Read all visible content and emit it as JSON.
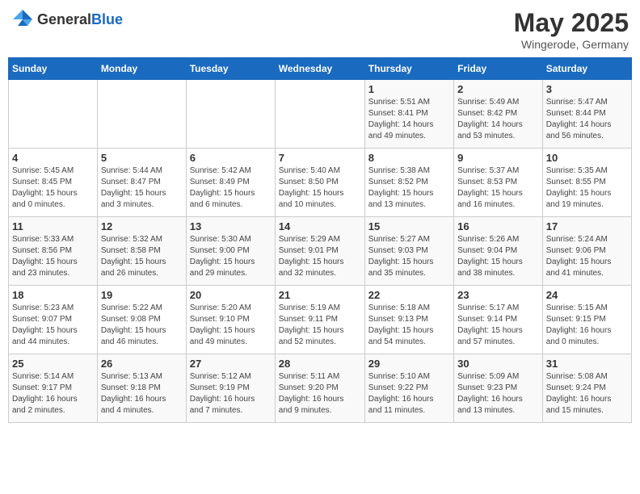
{
  "header": {
    "logo_general": "General",
    "logo_blue": "Blue",
    "title": "May 2025",
    "subtitle": "Wingerode, Germany"
  },
  "weekdays": [
    "Sunday",
    "Monday",
    "Tuesday",
    "Wednesday",
    "Thursday",
    "Friday",
    "Saturday"
  ],
  "weeks": [
    [
      {
        "day": "",
        "info": ""
      },
      {
        "day": "",
        "info": ""
      },
      {
        "day": "",
        "info": ""
      },
      {
        "day": "",
        "info": ""
      },
      {
        "day": "1",
        "info": "Sunrise: 5:51 AM\nSunset: 8:41 PM\nDaylight: 14 hours\nand 49 minutes."
      },
      {
        "day": "2",
        "info": "Sunrise: 5:49 AM\nSunset: 8:42 PM\nDaylight: 14 hours\nand 53 minutes."
      },
      {
        "day": "3",
        "info": "Sunrise: 5:47 AM\nSunset: 8:44 PM\nDaylight: 14 hours\nand 56 minutes."
      }
    ],
    [
      {
        "day": "4",
        "info": "Sunrise: 5:45 AM\nSunset: 8:45 PM\nDaylight: 15 hours\nand 0 minutes."
      },
      {
        "day": "5",
        "info": "Sunrise: 5:44 AM\nSunset: 8:47 PM\nDaylight: 15 hours\nand 3 minutes."
      },
      {
        "day": "6",
        "info": "Sunrise: 5:42 AM\nSunset: 8:49 PM\nDaylight: 15 hours\nand 6 minutes."
      },
      {
        "day": "7",
        "info": "Sunrise: 5:40 AM\nSunset: 8:50 PM\nDaylight: 15 hours\nand 10 minutes."
      },
      {
        "day": "8",
        "info": "Sunrise: 5:38 AM\nSunset: 8:52 PM\nDaylight: 15 hours\nand 13 minutes."
      },
      {
        "day": "9",
        "info": "Sunrise: 5:37 AM\nSunset: 8:53 PM\nDaylight: 15 hours\nand 16 minutes."
      },
      {
        "day": "10",
        "info": "Sunrise: 5:35 AM\nSunset: 8:55 PM\nDaylight: 15 hours\nand 19 minutes."
      }
    ],
    [
      {
        "day": "11",
        "info": "Sunrise: 5:33 AM\nSunset: 8:56 PM\nDaylight: 15 hours\nand 23 minutes."
      },
      {
        "day": "12",
        "info": "Sunrise: 5:32 AM\nSunset: 8:58 PM\nDaylight: 15 hours\nand 26 minutes."
      },
      {
        "day": "13",
        "info": "Sunrise: 5:30 AM\nSunset: 9:00 PM\nDaylight: 15 hours\nand 29 minutes."
      },
      {
        "day": "14",
        "info": "Sunrise: 5:29 AM\nSunset: 9:01 PM\nDaylight: 15 hours\nand 32 minutes."
      },
      {
        "day": "15",
        "info": "Sunrise: 5:27 AM\nSunset: 9:03 PM\nDaylight: 15 hours\nand 35 minutes."
      },
      {
        "day": "16",
        "info": "Sunrise: 5:26 AM\nSunset: 9:04 PM\nDaylight: 15 hours\nand 38 minutes."
      },
      {
        "day": "17",
        "info": "Sunrise: 5:24 AM\nSunset: 9:06 PM\nDaylight: 15 hours\nand 41 minutes."
      }
    ],
    [
      {
        "day": "18",
        "info": "Sunrise: 5:23 AM\nSunset: 9:07 PM\nDaylight: 15 hours\nand 44 minutes."
      },
      {
        "day": "19",
        "info": "Sunrise: 5:22 AM\nSunset: 9:08 PM\nDaylight: 15 hours\nand 46 minutes."
      },
      {
        "day": "20",
        "info": "Sunrise: 5:20 AM\nSunset: 9:10 PM\nDaylight: 15 hours\nand 49 minutes."
      },
      {
        "day": "21",
        "info": "Sunrise: 5:19 AM\nSunset: 9:11 PM\nDaylight: 15 hours\nand 52 minutes."
      },
      {
        "day": "22",
        "info": "Sunrise: 5:18 AM\nSunset: 9:13 PM\nDaylight: 15 hours\nand 54 minutes."
      },
      {
        "day": "23",
        "info": "Sunrise: 5:17 AM\nSunset: 9:14 PM\nDaylight: 15 hours\nand 57 minutes."
      },
      {
        "day": "24",
        "info": "Sunrise: 5:15 AM\nSunset: 9:15 PM\nDaylight: 16 hours\nand 0 minutes."
      }
    ],
    [
      {
        "day": "25",
        "info": "Sunrise: 5:14 AM\nSunset: 9:17 PM\nDaylight: 16 hours\nand 2 minutes."
      },
      {
        "day": "26",
        "info": "Sunrise: 5:13 AM\nSunset: 9:18 PM\nDaylight: 16 hours\nand 4 minutes."
      },
      {
        "day": "27",
        "info": "Sunrise: 5:12 AM\nSunset: 9:19 PM\nDaylight: 16 hours\nand 7 minutes."
      },
      {
        "day": "28",
        "info": "Sunrise: 5:11 AM\nSunset: 9:20 PM\nDaylight: 16 hours\nand 9 minutes."
      },
      {
        "day": "29",
        "info": "Sunrise: 5:10 AM\nSunset: 9:22 PM\nDaylight: 16 hours\nand 11 minutes."
      },
      {
        "day": "30",
        "info": "Sunrise: 5:09 AM\nSunset: 9:23 PM\nDaylight: 16 hours\nand 13 minutes."
      },
      {
        "day": "31",
        "info": "Sunrise: 5:08 AM\nSunset: 9:24 PM\nDaylight: 16 hours\nand 15 minutes."
      }
    ]
  ]
}
